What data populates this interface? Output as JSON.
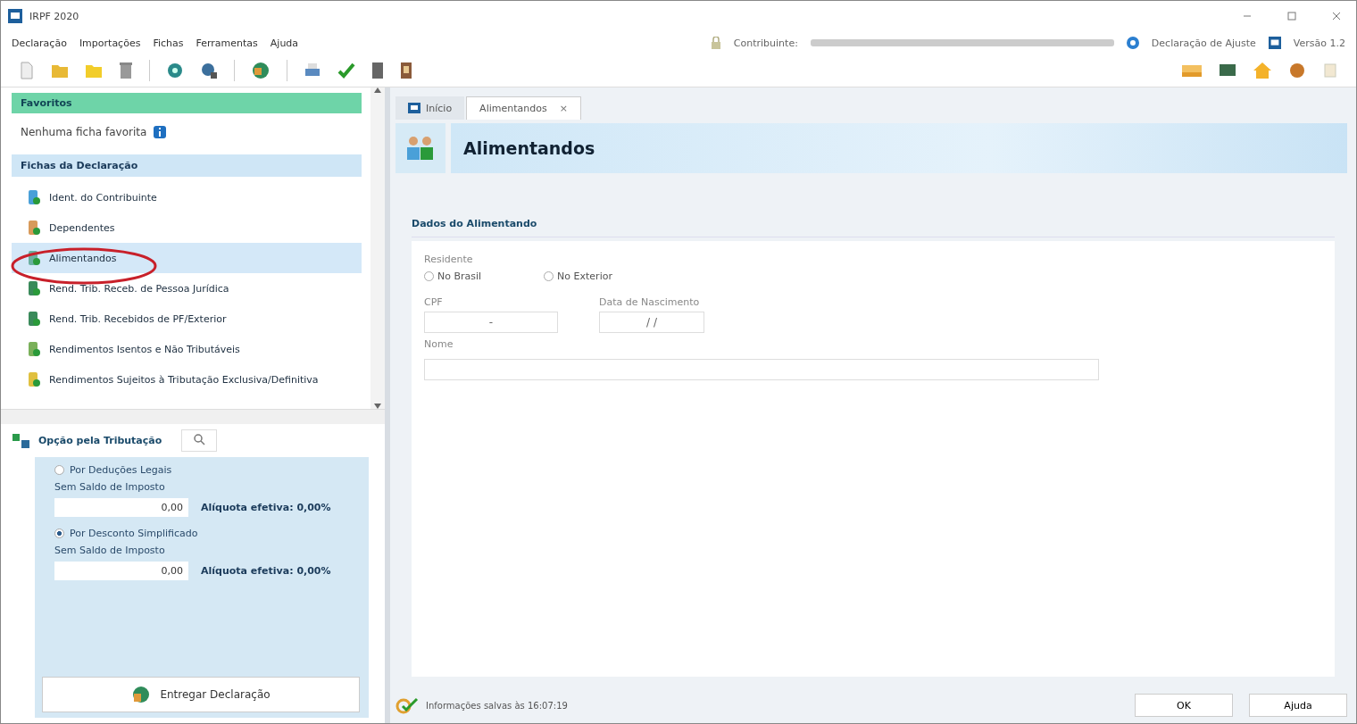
{
  "window": {
    "title": "IRPF 2020"
  },
  "menu": [
    "Declaração",
    "Importações",
    "Fichas",
    "Ferramentas",
    "Ajuda"
  ],
  "header_info": {
    "contribuinte_label": "Contribuinte:",
    "declaration": "Declaração de Ajuste",
    "version": "Versão 1.2"
  },
  "favorites": {
    "title": "Favoritos",
    "empty_text": "Nenhuma ficha favorita"
  },
  "fichas": {
    "title": "Fichas da Declaração",
    "items": [
      {
        "label": "Ident. do Contribuinte",
        "selected": false
      },
      {
        "label": "Dependentes",
        "selected": false
      },
      {
        "label": "Alimentandos",
        "selected": true
      },
      {
        "label": "Rend. Trib. Receb. de Pessoa Jurídica",
        "selected": false
      },
      {
        "label": "Rend. Trib. Recebidos de PF/Exterior",
        "selected": false
      },
      {
        "label": "Rendimentos Isentos e Não Tributáveis",
        "selected": false
      },
      {
        "label": "Rendimentos Sujeitos à Tributação Exclusiva/Definitiva",
        "selected": false
      }
    ]
  },
  "opcao": {
    "title": "Opção pela Tributação",
    "options": [
      {
        "label": "Por Deduções Legais",
        "selected": false,
        "saldo": "Sem Saldo de Imposto",
        "value": "0,00",
        "aliquota": "Alíquota efetiva: 0,00%"
      },
      {
        "label": "Por Desconto Simplificado",
        "selected": true,
        "saldo": "Sem Saldo de Imposto",
        "value": "0,00",
        "aliquota": "Alíquota efetiva: 0,00%"
      }
    ],
    "button": "Entregar Declaração"
  },
  "tabs": [
    {
      "label": "Início",
      "selected": false,
      "closable": false
    },
    {
      "label": "Alimentandos",
      "selected": true,
      "closable": true
    }
  ],
  "close_glyph": "×",
  "page_title": "Alimentandos",
  "form": {
    "section": "Dados do Alimentando",
    "residente_label": "Residente",
    "residente_options": [
      {
        "label": "No Brasil",
        "selected": false
      },
      {
        "label": "No Exterior",
        "selected": false
      }
    ],
    "cpf_label": "CPF",
    "cpf_value": "-",
    "birth_label": "Data de Nascimento",
    "birth_value": "/ /",
    "name_label": "Nome"
  },
  "status": "Informações salvas às 16:07:19",
  "buttons": [
    "OK",
    "Ajuda"
  ]
}
